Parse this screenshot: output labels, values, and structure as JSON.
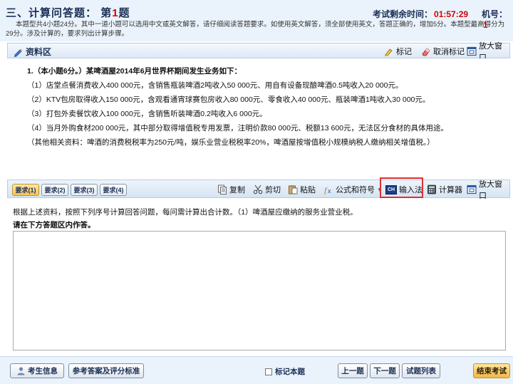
{
  "header": {
    "section_title": "三、计算问答题：",
    "question_prefix": "第",
    "question_number": "1",
    "question_suffix": "题",
    "timer_label": "考试剩余时间：",
    "timer_value": "01:57:29",
    "machine_label": "机号：",
    "machine_value": "1",
    "instructions": "本题型共4小题24分。其中一道小题可以选用中文或英文解答，请仔细阅读答题要求。如使用英文解答，须全部使用英文，答题正确的，增加5分。本题型最高得分为29分。涉及计算的，要求列出计算步骤。"
  },
  "material": {
    "title": "资料区",
    "toolbar": {
      "mark": "标记",
      "unmark": "取消标记",
      "enlarge": "放大窗口"
    },
    "lines": [
      "1.（本小题6分。）某啤酒屋2014年6月世界杯期间发生业务如下：",
      "（1）店堂点餐消费收入400 000元，含销售瓶装啤酒2吨收入50 000元、用自有设备现酿啤酒0.5吨收入20 000元。",
      "（2）KTV包房取得收入150 000元，含观看通宵球赛包房收入80 000元、零食收入40 000元、瓶装啤酒1吨收入30 000元。",
      "（3）打包外卖餐饮收入100 000元，含销售听装啤酒0.2吨收入6 000元。",
      "（4）当月外购食材200 000元，其中部分取得增值税专用发票，注明价款80 000元、税额13 600元，无法区分食材的具体用途。",
      "（其他相关资料：啤酒的消费税税率为250元/吨，娱乐业营业税税率20%，啤酒屋按增值税小规模纳税人缴纳相关增值税。）"
    ]
  },
  "answer_toolbar": {
    "tabs": [
      "要求(1)",
      "要求(2)",
      "要求(3)",
      "要求(4)"
    ],
    "copy": "复制",
    "cut": "剪切",
    "paste": "粘贴",
    "formula": "公式和符号",
    "ime": "输入法",
    "ime_icon": "CH",
    "calculator": "计算器",
    "enlarge": "放大窗口"
  },
  "question": {
    "text": "根据上述资料，按照下列序号计算回答问题，每问需计算出合计数。（1）啤酒屋应缴纳的服务业营业税。",
    "prompt": "请在下方答题区内作答。"
  },
  "footer": {
    "candidate_info": "考生信息",
    "reference": "参考答案及评分标准",
    "mark_question": "标记本题",
    "prev": "上一题",
    "next": "下一题",
    "question_list": "试题列表",
    "end_exam": "结束考试"
  },
  "colors": {
    "accent_red": "#d40000",
    "header_bg": "#eaf3fc",
    "toolbar_border": "#b8cde4",
    "active_tab": "#f5c35b",
    "highlight_box": "#e03030"
  }
}
